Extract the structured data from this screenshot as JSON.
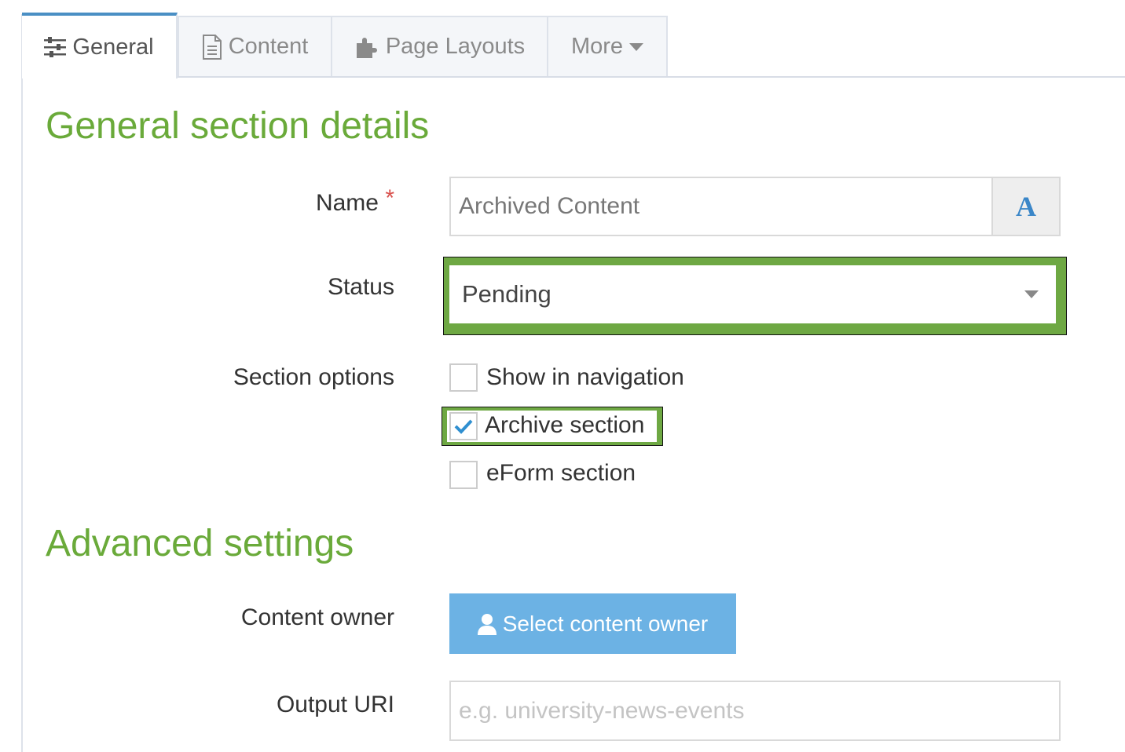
{
  "tabs": [
    {
      "label": "General",
      "icon": "sliders-icon",
      "active": true
    },
    {
      "label": "Content",
      "icon": "document-icon",
      "active": false
    },
    {
      "label": "Page Layouts",
      "icon": "puzzle-icon",
      "active": false
    },
    {
      "label": "More",
      "icon": "caret-down-icon",
      "active": false
    }
  ],
  "general": {
    "heading": "General section details",
    "name_label": "Name",
    "required_mark": "*",
    "name_value": "Archived Content",
    "name_button": "A",
    "status_label": "Status",
    "status_value": "Pending",
    "options_label": "Section options",
    "options": [
      {
        "label": "Show in navigation",
        "checked": false
      },
      {
        "label": "Archive section",
        "checked": true
      },
      {
        "label": "eForm section",
        "checked": false
      }
    ]
  },
  "advanced": {
    "heading": "Advanced settings",
    "owner_label": "Content owner",
    "owner_button": "Select content owner",
    "uri_label": "Output URI",
    "uri_placeholder": "e.g. university-news-events"
  },
  "colors": {
    "accent_green": "#6aaa3a",
    "highlight": "#6ea843",
    "button_blue": "#6cb2e4",
    "tab_active": "#4a8fc4"
  }
}
